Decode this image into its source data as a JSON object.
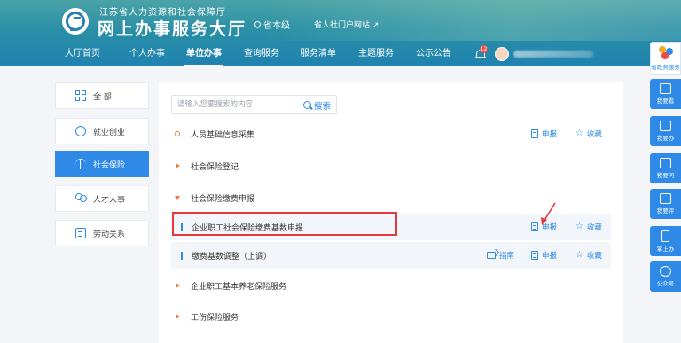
{
  "header": {
    "org": "江苏省人力资源和社会保障厅",
    "title": "网上办事服务大厅",
    "location": "省本级",
    "portal_link": "省人社门户网站 ↗",
    "notification_count": "12"
  },
  "nav": {
    "items": [
      {
        "label": "大厅首页"
      },
      {
        "label": "个人办事"
      },
      {
        "label": "单位办事"
      },
      {
        "label": "查询服务"
      },
      {
        "label": "服务清单"
      },
      {
        "label": "主题服务"
      },
      {
        "label": "公示公告"
      }
    ],
    "active_index": 2
  },
  "categories": [
    {
      "label": "全 部",
      "icon": "grid-icon"
    },
    {
      "label": "就业创业",
      "icon": "badge-icon"
    },
    {
      "label": "社会保险",
      "icon": "umbrella-icon"
    },
    {
      "label": "人才人事",
      "icon": "people-icon"
    },
    {
      "label": "劳动关系",
      "icon": "document-icon"
    }
  ],
  "active_category": "社会保险",
  "search": {
    "placeholder": "请输入您要搜索的内容",
    "button_label": "搜索"
  },
  "services": [
    {
      "label": "人员基础信息采集",
      "type": "item",
      "actions": {
        "declare": "申报",
        "favorite": "收藏"
      }
    },
    {
      "label": "社会保险登记",
      "type": "collapsed"
    },
    {
      "label": "社会保险缴费申报",
      "type": "expanded"
    },
    {
      "label": "企业职工社会保险缴费基数申报",
      "type": "sub",
      "highlighted": true,
      "actions": {
        "declare": "申报",
        "favorite": "收藏"
      }
    },
    {
      "label": "缴费基数调整（上调）",
      "type": "sub",
      "actions": {
        "guide": "指南",
        "declare": "申报",
        "favorite": "收藏"
      }
    },
    {
      "label": "企业职工基本养老保险服务",
      "type": "collapsed"
    },
    {
      "label": "工伤保险服务",
      "type": "collapsed"
    }
  ],
  "right_toolbar": [
    {
      "label": "省政务服务",
      "icon": "gov-logo-icon"
    },
    {
      "label": "我要看",
      "icon": "book-icon"
    },
    {
      "label": "我要办",
      "icon": "monitor-icon"
    },
    {
      "label": "我要问",
      "icon": "question-icon"
    },
    {
      "label": "我要评",
      "icon": "edit-icon"
    },
    {
      "label": "掌上办",
      "icon": "phone-icon"
    },
    {
      "label": "公众号",
      "icon": "wechat-icon"
    }
  ],
  "colors": {
    "primary": "#2e8ae6",
    "accent_orange": "#f07a3a",
    "highlight_red": "#e23a3a"
  }
}
